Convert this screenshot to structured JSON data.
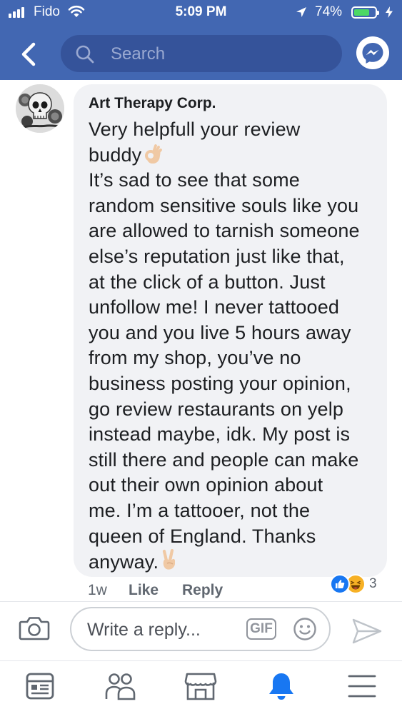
{
  "status_bar": {
    "carrier": "Fido",
    "time": "5:09 PM",
    "battery_percent": "74%",
    "battery_level": 0.74,
    "signal_bars": 4
  },
  "header": {
    "search_placeholder": "Search",
    "icons": [
      "back-chevron-icon",
      "search-icon",
      "messenger-icon"
    ]
  },
  "comment": {
    "author": "Art Therapy Corp.",
    "body_lines": [
      "Very helpfull your review",
      "buddy",
      "It’s sad to see that some",
      "random sensitive souls like you",
      "are allowed to tarnish someone",
      "else’s reputation just like that,",
      "at the click of a button. Just",
      "unfollow me! I never tattooed",
      "you and you live 5 hours away",
      "from my shop, you’ve no",
      "business posting your opinion,",
      "go review restaurants on yelp",
      "instead maybe, idk. My post is",
      "still there and people can make",
      "out their own opinion about",
      "me. I’m a tattooer, not the",
      "queen of England. Thanks",
      "anyway."
    ],
    "emojis": [
      "ok-hand-emoji",
      "victory-hand-emoji"
    ],
    "timestamp": "1w",
    "like_label": "Like",
    "reply_label": "Reply",
    "reactions": [
      "like-reaction",
      "haha-reaction"
    ],
    "reaction_count": "3"
  },
  "composer": {
    "placeholder": "Write a reply...",
    "gif_label": "GIF"
  },
  "bottom_nav": {
    "items": [
      "news-feed-icon",
      "groups-icon",
      "marketplace-icon",
      "notifications-icon",
      "menu-icon"
    ],
    "active": "notifications-icon"
  },
  "colors": {
    "brand_blue": "#4267b2",
    "search_bg": "#35539a",
    "bubble_bg": "#f1f2f5",
    "active_blue": "#1877f2",
    "battery_green": "#4cd964"
  }
}
